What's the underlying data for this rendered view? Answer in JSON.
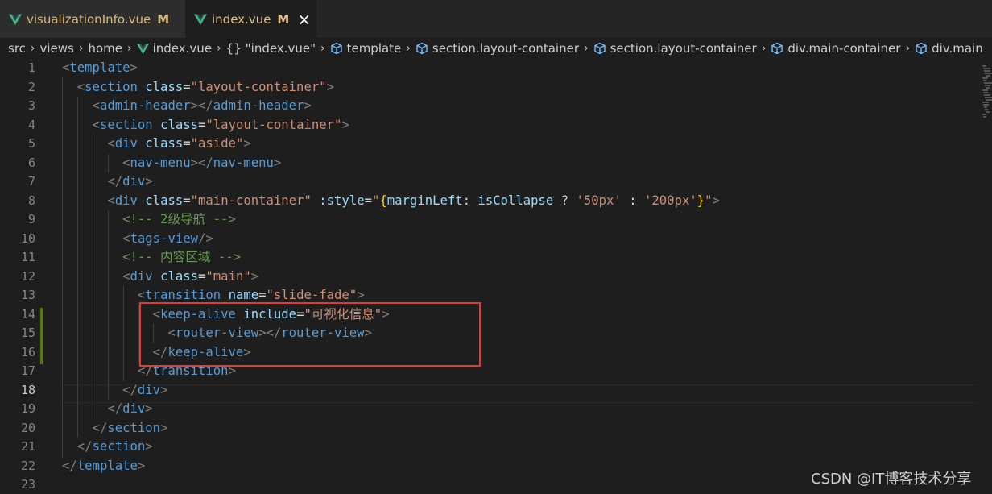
{
  "tabs": [
    {
      "label": "visualizationInfo.vue",
      "modified": "M",
      "icon": "vue-icon"
    },
    {
      "label": "index.vue",
      "modified": "M",
      "icon": "vue-icon",
      "close": "×"
    }
  ],
  "breadcrumb": [
    {
      "label": "src"
    },
    {
      "label": "views"
    },
    {
      "label": "home"
    },
    {
      "label": "index.vue",
      "icon": "vue-icon"
    },
    {
      "label": "\"index.vue\"",
      "icon": "{}"
    },
    {
      "label": "template",
      "icon": "cube-icon"
    },
    {
      "label": "section.layout-container",
      "icon": "cube-icon"
    },
    {
      "label": "section.layout-container",
      "icon": "cube-icon"
    },
    {
      "label": "div.main-container",
      "icon": "cube-icon"
    },
    {
      "label": "div.main",
      "icon": "cube-icon"
    }
  ],
  "editor": {
    "line_numbers": [
      "1",
      "2",
      "3",
      "4",
      "5",
      "6",
      "7",
      "8",
      "9",
      "10",
      "11",
      "12",
      "13",
      "14",
      "15",
      "16",
      "17",
      "18",
      "19",
      "20",
      "21",
      "22",
      "23"
    ],
    "active_line": "18",
    "lines": [
      [
        [
          "b",
          "<"
        ],
        [
          "t",
          "template"
        ],
        [
          "b",
          ">"
        ]
      ],
      [
        [
          "p",
          "  "
        ],
        [
          "b",
          "<"
        ],
        [
          "t",
          "section"
        ],
        [
          "p",
          " "
        ],
        [
          "a",
          "class"
        ],
        [
          "p",
          "="
        ],
        [
          "s",
          "\"layout-container\""
        ],
        [
          "b",
          ">"
        ]
      ],
      [
        [
          "p",
          "    "
        ],
        [
          "b",
          "<"
        ],
        [
          "t",
          "admin-header"
        ],
        [
          "b",
          "></"
        ],
        [
          "t",
          "admin-header"
        ],
        [
          "b",
          ">"
        ]
      ],
      [
        [
          "p",
          "    "
        ],
        [
          "b",
          "<"
        ],
        [
          "t",
          "section"
        ],
        [
          "p",
          " "
        ],
        [
          "a",
          "class"
        ],
        [
          "p",
          "="
        ],
        [
          "s",
          "\"layout-container\""
        ],
        [
          "b",
          ">"
        ]
      ],
      [
        [
          "p",
          "      "
        ],
        [
          "b",
          "<"
        ],
        [
          "t",
          "div"
        ],
        [
          "p",
          " "
        ],
        [
          "a",
          "class"
        ],
        [
          "p",
          "="
        ],
        [
          "s",
          "\"aside\""
        ],
        [
          "b",
          ">"
        ]
      ],
      [
        [
          "p",
          "        "
        ],
        [
          "b",
          "<"
        ],
        [
          "t",
          "nav-menu"
        ],
        [
          "b",
          "></"
        ],
        [
          "t",
          "nav-menu"
        ],
        [
          "b",
          ">"
        ]
      ],
      [
        [
          "p",
          "      "
        ],
        [
          "b",
          "</"
        ],
        [
          "t",
          "div"
        ],
        [
          "b",
          ">"
        ]
      ],
      [
        [
          "p",
          "      "
        ],
        [
          "b",
          "<"
        ],
        [
          "t",
          "div"
        ],
        [
          "p",
          " "
        ],
        [
          "a",
          "class"
        ],
        [
          "p",
          "="
        ],
        [
          "s",
          "\"main-container\""
        ],
        [
          "p",
          " "
        ],
        [
          "a",
          ":style"
        ],
        [
          "p",
          "="
        ],
        [
          "s",
          "\""
        ],
        [
          "y",
          "{"
        ],
        [
          "a",
          "marginLeft"
        ],
        [
          "p",
          ": "
        ],
        [
          "a",
          "isCollapse"
        ],
        [
          "p",
          " ? "
        ],
        [
          "s",
          "'50px'"
        ],
        [
          "p",
          " : "
        ],
        [
          "s",
          "'200px'"
        ],
        [
          "y",
          "}"
        ],
        [
          "s",
          "\""
        ],
        [
          "b",
          ">"
        ]
      ],
      [
        [
          "p",
          "        "
        ],
        [
          "c",
          "<!-- 2级导航 -->"
        ]
      ],
      [
        [
          "p",
          "        "
        ],
        [
          "b",
          "<"
        ],
        [
          "t",
          "tags-view"
        ],
        [
          "b",
          "/>"
        ]
      ],
      [
        [
          "p",
          "        "
        ],
        [
          "c",
          "<!-- 内容区域 -->"
        ]
      ],
      [
        [
          "p",
          "        "
        ],
        [
          "b",
          "<"
        ],
        [
          "t",
          "div"
        ],
        [
          "p",
          " "
        ],
        [
          "a",
          "class"
        ],
        [
          "p",
          "="
        ],
        [
          "s",
          "\"main\""
        ],
        [
          "b",
          ">"
        ]
      ],
      [
        [
          "p",
          "          "
        ],
        [
          "b",
          "<"
        ],
        [
          "t",
          "transition"
        ],
        [
          "p",
          " "
        ],
        [
          "a",
          "name"
        ],
        [
          "p",
          "="
        ],
        [
          "s",
          "\"slide-fade\""
        ],
        [
          "b",
          ">"
        ]
      ],
      [
        [
          "p",
          "            "
        ],
        [
          "b",
          "<"
        ],
        [
          "t",
          "keep-alive"
        ],
        [
          "p",
          " "
        ],
        [
          "a",
          "include"
        ],
        [
          "p",
          "="
        ],
        [
          "s",
          "\"可视化信息\""
        ],
        [
          "b",
          ">"
        ]
      ],
      [
        [
          "p",
          "              "
        ],
        [
          "b",
          "<"
        ],
        [
          "t",
          "router-view"
        ],
        [
          "b",
          "></"
        ],
        [
          "t",
          "router-view"
        ],
        [
          "b",
          ">"
        ]
      ],
      [
        [
          "p",
          "            "
        ],
        [
          "b",
          "</"
        ],
        [
          "t",
          "keep-alive"
        ],
        [
          "b",
          ">"
        ]
      ],
      [
        [
          "p",
          "          "
        ],
        [
          "b",
          "</"
        ],
        [
          "t",
          "transition"
        ],
        [
          "b",
          ">"
        ]
      ],
      [
        [
          "p",
          "        "
        ],
        [
          "b",
          "</"
        ],
        [
          "t",
          "div"
        ],
        [
          "b",
          ">"
        ]
      ],
      [
        [
          "p",
          "      "
        ],
        [
          "b",
          "</"
        ],
        [
          "t",
          "div"
        ],
        [
          "b",
          ">"
        ]
      ],
      [
        [
          "p",
          "    "
        ],
        [
          "b",
          "</"
        ],
        [
          "t",
          "section"
        ],
        [
          "b",
          ">"
        ]
      ],
      [
        [
          "p",
          "  "
        ],
        [
          "b",
          "</"
        ],
        [
          "t",
          "section"
        ],
        [
          "b",
          ">"
        ]
      ],
      [
        [
          "b",
          "</"
        ],
        [
          "t",
          "template"
        ],
        [
          "b",
          ">"
        ]
      ],
      []
    ]
  },
  "colors": {
    "tag": "#569cd6",
    "attribute": "#9cdcfe",
    "string": "#ce9178",
    "comment": "#6a9955",
    "bracket": "#808080",
    "highlight_box": "#e53935"
  },
  "watermark": "CSDN @IT博客技术分享"
}
